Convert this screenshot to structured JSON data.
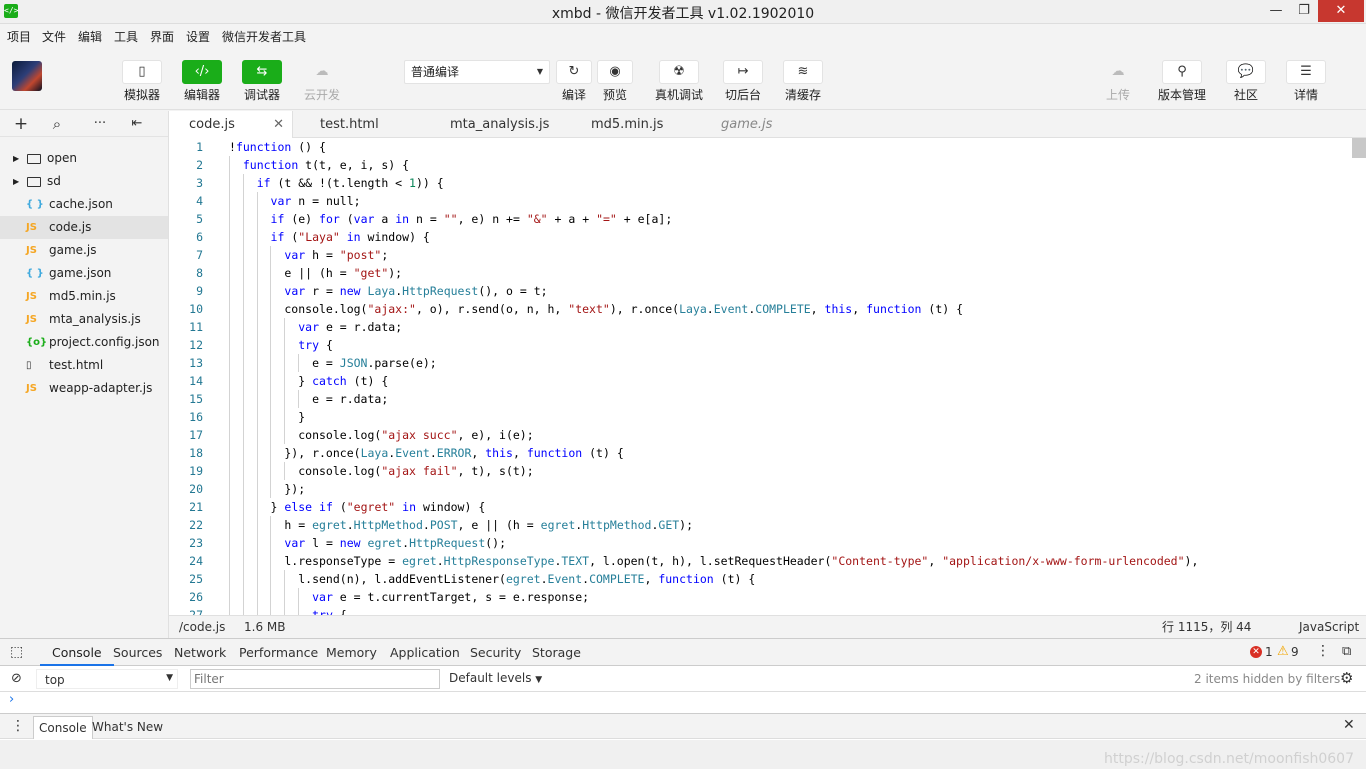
{
  "window": {
    "title": "xmbd - 微信开发者工具 v1.02.1902010",
    "app_icon": "</>"
  },
  "window_controls": {
    "minimize": "—",
    "maximize": "❐",
    "close": "✕"
  },
  "menu": [
    "项目",
    "文件",
    "编辑",
    "工具",
    "界面",
    "设置",
    "微信开发者工具"
  ],
  "toolbar": {
    "simulator": "模拟器",
    "editor": "编辑器",
    "debugger": "调试器",
    "cloud": "云开发",
    "compile_mode": "普通编译",
    "compile": "编译",
    "preview": "预览",
    "remote_debug": "真机调试",
    "background": "切后台",
    "clear_cache": "清缓存",
    "upload": "上传",
    "version": "版本管理",
    "community": "社区",
    "details": "详情"
  },
  "icons": {
    "simulator": "▯",
    "editor": "‹/›",
    "debugger": "⇆",
    "cloud": "☁",
    "compile": "↻",
    "preview": "◉",
    "remote_debug": "☢",
    "background": "↦",
    "clear_cache": "≋",
    "upload": "☁",
    "version": "⚲",
    "community": "💬",
    "details": "☰",
    "add": "+",
    "search": "⌕",
    "more": "···",
    "collapse": "⇤"
  },
  "files": [
    {
      "type": "folder",
      "name": "open"
    },
    {
      "type": "folder",
      "name": "sd"
    },
    {
      "type": "json",
      "icon": "{ }",
      "name": "cache.json"
    },
    {
      "type": "js",
      "icon": "JS",
      "name": "code.js",
      "active": true
    },
    {
      "type": "js",
      "icon": "JS",
      "name": "game.js"
    },
    {
      "type": "json",
      "icon": "{ }",
      "name": "game.json"
    },
    {
      "type": "js",
      "icon": "JS",
      "name": "md5.min.js"
    },
    {
      "type": "js",
      "icon": "JS",
      "name": "mta_analysis.js"
    },
    {
      "type": "config",
      "icon": "{o}",
      "name": "project.config.json"
    },
    {
      "type": "html",
      "icon": "▯",
      "name": "test.html"
    },
    {
      "type": "js",
      "icon": "JS",
      "name": "weapp-adapter.js"
    }
  ],
  "tabs": [
    {
      "label": "code.js",
      "active": true,
      "close": "✕"
    },
    {
      "label": "test.html"
    },
    {
      "label": "mta_analysis.js"
    },
    {
      "label": "md5.min.js"
    },
    {
      "label": "game.js",
      "preview": true
    }
  ],
  "code_lines": [
    "!function () {",
    "  function t(t, e, i, s) {",
    "    if (t && !(t.length < 1)) {",
    "      var n = null;",
    "      if (e) for (var a in n = \"\", e) n += \"&\" + a + \"=\" + e[a];",
    "      if (\"Laya\" in window) {",
    "        var h = \"post\";",
    "        e || (h = \"get\");",
    "        var r = new Laya.HttpRequest(), o = t;",
    "        console.log(\"ajax:\", o), r.send(o, n, h, \"text\"), r.once(Laya.Event.COMPLETE, this, function (t) {",
    "          var e = r.data;",
    "          try {",
    "            e = JSON.parse(e);",
    "          } catch (t) {",
    "            e = r.data;",
    "          }",
    "          console.log(\"ajax succ\", e), i(e);",
    "        }), r.once(Laya.Event.ERROR, this, function (t) {",
    "          console.log(\"ajax fail\", t), s(t);",
    "        });",
    "      } else if (\"egret\" in window) {",
    "        h = egret.HttpMethod.POST, e || (h = egret.HttpMethod.GET);",
    "        var l = new egret.HttpRequest();",
    "        l.responseType = egret.HttpResponseType.TEXT, l.open(t, h), l.setRequestHeader(\"Content-type\", \"application/x-www-form-urlencoded\"),",
    "          l.send(n), l.addEventListener(egret.Event.COMPLETE, function (t) {",
    "            var e = t.currentTarget, s = e.response;",
    "            try {"
  ],
  "status": {
    "path": "/code.js",
    "size": "1.6 MB",
    "cursor": "行 1115，列 44",
    "language": "JavaScript"
  },
  "devtools": {
    "tabs": [
      "Console",
      "Sources",
      "Network",
      "Performance",
      "Memory",
      "Application",
      "Security",
      "Storage"
    ],
    "error_count": "1",
    "warning_count": "9",
    "context": "top",
    "filter_placeholder": "Filter",
    "levels": "Default levels",
    "hidden": "2 items hidden by filters",
    "drawer_tabs": [
      "Console",
      "What's New"
    ]
  },
  "watermark": "https://blog.csdn.net/moonfish0607",
  "colors": {
    "accent_green": "#1aad19",
    "js_icon": "#f5a623",
    "json_icon": "#3fa9dd",
    "config_icon": "#1aad19",
    "close_red": "#c7372f",
    "tab_blue": "#1a73e8"
  }
}
